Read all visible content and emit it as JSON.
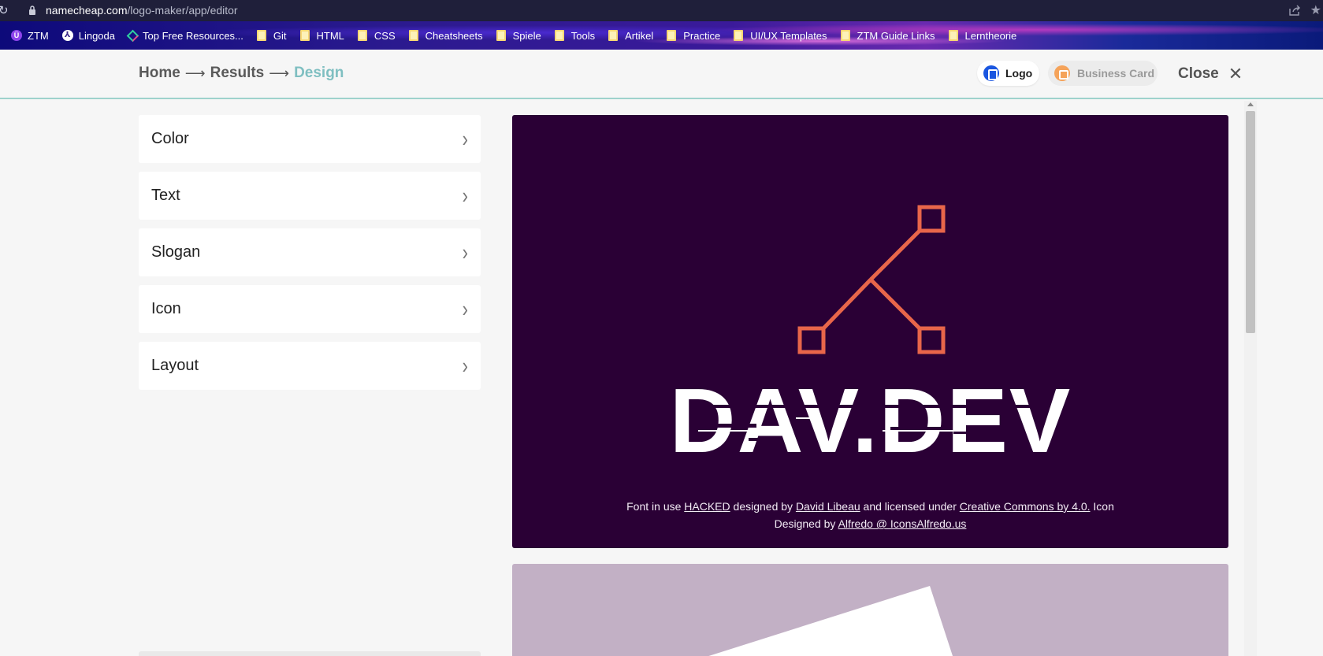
{
  "browser": {
    "url_host": "namecheap.com",
    "url_path": "/logo-maker/app/editor"
  },
  "bookmarks": [
    {
      "label": "ZTM",
      "icon": "ztm-icon"
    },
    {
      "label": "Lingoda",
      "icon": "lingoda-icon"
    },
    {
      "label": "Top Free Resources...",
      "icon": "resources-icon"
    },
    {
      "label": "Git",
      "icon": "folder-icon"
    },
    {
      "label": "HTML",
      "icon": "folder-icon"
    },
    {
      "label": "CSS",
      "icon": "folder-icon"
    },
    {
      "label": "Cheatsheets",
      "icon": "folder-icon"
    },
    {
      "label": "Spiele",
      "icon": "folder-icon"
    },
    {
      "label": "Tools",
      "icon": "folder-icon"
    },
    {
      "label": "Artikel",
      "icon": "folder-icon"
    },
    {
      "label": "Practice",
      "icon": "folder-icon"
    },
    {
      "label": "UI/UX Templates",
      "icon": "folder-icon"
    },
    {
      "label": "ZTM Guide Links",
      "icon": "folder-icon"
    },
    {
      "label": "Lerntheorie",
      "icon": "folder-icon"
    }
  ],
  "nav": {
    "breadcrumb": [
      "Home",
      "Results",
      "Design"
    ],
    "arrow": "⟶",
    "logo_tab": "Logo",
    "business_card_tab": "Business Card",
    "close_label": "Close"
  },
  "sidebar": {
    "items": [
      {
        "label": "Color"
      },
      {
        "label": "Text"
      },
      {
        "label": "Slogan"
      },
      {
        "label": "Icon"
      },
      {
        "label": "Layout"
      }
    ]
  },
  "preview": {
    "logo_text": "DAV.DEV",
    "background_color": "#2a0035",
    "icon_color": "#e8664a",
    "credits": {
      "t1": "Font in use ",
      "font_name": "HACKED",
      "t2": " designed by ",
      "font_author": "David Libeau",
      "t3": " and licensed under ",
      "license": "Creative Commons by 4.0.",
      "t4": " Icon",
      "t5": "Designed by ",
      "icon_author": "Alfredo @ IconsAlfredo.us"
    }
  },
  "colors": {
    "accent": "#7fbfc1",
    "preview2_bg": "#c2b0c5"
  }
}
